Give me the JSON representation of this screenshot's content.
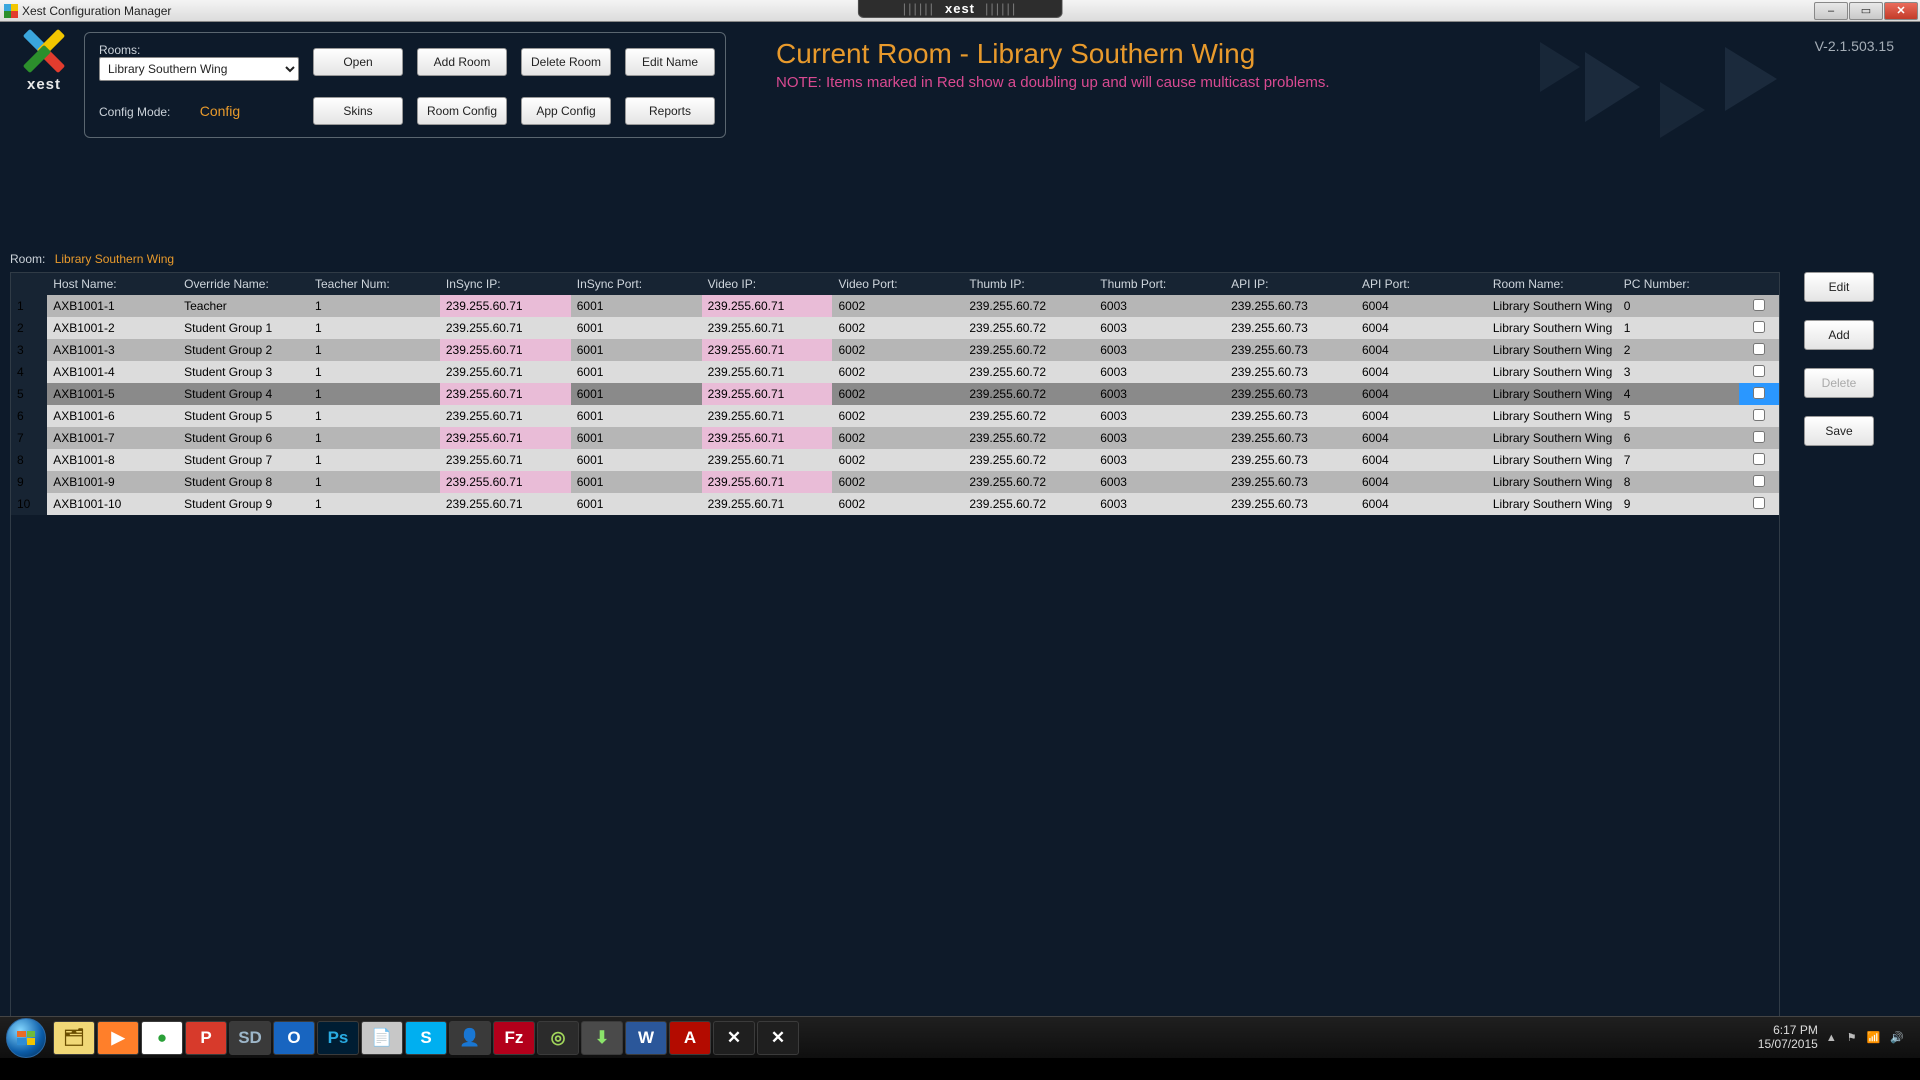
{
  "window": {
    "title": "Xest Configuration Manager",
    "brand": "xest"
  },
  "winbtns": {
    "min": "–",
    "max": "▭",
    "close": "✕"
  },
  "logo_text": "xest",
  "version": "V-2.1.503.15",
  "panel": {
    "rooms_label": "Rooms:",
    "room_selected": "Library Southern Wing",
    "config_mode_label": "Config Mode:",
    "config_mode_value": "Config",
    "buttons": {
      "open": "Open",
      "add_room": "Add Room",
      "delete_room": "Delete Room",
      "edit_name": "Edit Name",
      "skins": "Skins",
      "room_config": "Room Config",
      "app_config": "App Config",
      "reports": "Reports"
    }
  },
  "room_title": {
    "heading": "Current Room - Library Southern Wing",
    "note": "NOTE: Items marked in Red show a doubling up and will cause multicast problems."
  },
  "grid_header_room_label": "Room:",
  "grid_header_room_value": "Library Southern Wing",
  "columns": [
    "Host Name:",
    "Override Name:",
    "Teacher Num:",
    "InSync IP:",
    "InSync Port:",
    "Video IP:",
    "Video Port:",
    "Thumb IP:",
    "Thumb Port:",
    "API IP:",
    "API Port:",
    "Room Name:",
    "PC Number:"
  ],
  "selected_row": 5,
  "rows": [
    {
      "host": "AXB1001-1",
      "override": "Teacher",
      "tnum": "1",
      "insync_ip": "239.255.60.71",
      "insync_port": "6001",
      "video_ip": "239.255.60.71",
      "video_port": "6002",
      "thumb_ip": "239.255.60.72",
      "thumb_port": "6003",
      "api_ip": "239.255.60.73",
      "api_port": "6004",
      "room": "Library Southern Wing",
      "pc": "0"
    },
    {
      "host": "AXB1001-2",
      "override": "Student Group 1",
      "tnum": "1",
      "insync_ip": "239.255.60.71",
      "insync_port": "6001",
      "video_ip": "239.255.60.71",
      "video_port": "6002",
      "thumb_ip": "239.255.60.72",
      "thumb_port": "6003",
      "api_ip": "239.255.60.73",
      "api_port": "6004",
      "room": "Library Southern Wing",
      "pc": "1"
    },
    {
      "host": "AXB1001-3",
      "override": "Student Group 2",
      "tnum": "1",
      "insync_ip": "239.255.60.71",
      "insync_port": "6001",
      "video_ip": "239.255.60.71",
      "video_port": "6002",
      "thumb_ip": "239.255.60.72",
      "thumb_port": "6003",
      "api_ip": "239.255.60.73",
      "api_port": "6004",
      "room": "Library Southern Wing",
      "pc": "2"
    },
    {
      "host": "AXB1001-4",
      "override": "Student Group 3",
      "tnum": "1",
      "insync_ip": "239.255.60.71",
      "insync_port": "6001",
      "video_ip": "239.255.60.71",
      "video_port": "6002",
      "thumb_ip": "239.255.60.72",
      "thumb_port": "6003",
      "api_ip": "239.255.60.73",
      "api_port": "6004",
      "room": "Library Southern Wing",
      "pc": "3"
    },
    {
      "host": "AXB1001-5",
      "override": "Student Group 4",
      "tnum": "1",
      "insync_ip": "239.255.60.71",
      "insync_port": "6001",
      "video_ip": "239.255.60.71",
      "video_port": "6002",
      "thumb_ip": "239.255.60.72",
      "thumb_port": "6003",
      "api_ip": "239.255.60.73",
      "api_port": "6004",
      "room": "Library Southern Wing",
      "pc": "4"
    },
    {
      "host": "AXB1001-6",
      "override": "Student Group 5",
      "tnum": "1",
      "insync_ip": "239.255.60.71",
      "insync_port": "6001",
      "video_ip": "239.255.60.71",
      "video_port": "6002",
      "thumb_ip": "239.255.60.72",
      "thumb_port": "6003",
      "api_ip": "239.255.60.73",
      "api_port": "6004",
      "room": "Library Southern Wing",
      "pc": "5"
    },
    {
      "host": "AXB1001-7",
      "override": "Student Group 6",
      "tnum": "1",
      "insync_ip": "239.255.60.71",
      "insync_port": "6001",
      "video_ip": "239.255.60.71",
      "video_port": "6002",
      "thumb_ip": "239.255.60.72",
      "thumb_port": "6003",
      "api_ip": "239.255.60.73",
      "api_port": "6004",
      "room": "Library Southern Wing",
      "pc": "6"
    },
    {
      "host": "AXB1001-8",
      "override": "Student Group 7",
      "tnum": "1",
      "insync_ip": "239.255.60.71",
      "insync_port": "6001",
      "video_ip": "239.255.60.71",
      "video_port": "6002",
      "thumb_ip": "239.255.60.72",
      "thumb_port": "6003",
      "api_ip": "239.255.60.73",
      "api_port": "6004",
      "room": "Library Southern Wing",
      "pc": "7"
    },
    {
      "host": "AXB1001-9",
      "override": "Student Group 8",
      "tnum": "1",
      "insync_ip": "239.255.60.71",
      "insync_port": "6001",
      "video_ip": "239.255.60.71",
      "video_port": "6002",
      "thumb_ip": "239.255.60.72",
      "thumb_port": "6003",
      "api_ip": "239.255.60.73",
      "api_port": "6004",
      "room": "Library Southern Wing",
      "pc": "8"
    },
    {
      "host": "AXB1001-10",
      "override": "Student Group 9",
      "tnum": "1",
      "insync_ip": "239.255.60.71",
      "insync_port": "6001",
      "video_ip": "239.255.60.71",
      "video_port": "6002",
      "thumb_ip": "239.255.60.72",
      "thumb_port": "6003",
      "api_ip": "239.255.60.73",
      "api_port": "6004",
      "room": "Library Southern Wing",
      "pc": "9"
    }
  ],
  "sidebtns": {
    "edit": "Edit",
    "add": "Add",
    "delete": "Delete",
    "save": "Save"
  },
  "taskbar": {
    "items": [
      {
        "bg": "#f1d877",
        "fg": "#6b4e00",
        "txt": "🗂"
      },
      {
        "bg": "#ff7f2a",
        "fg": "#fff",
        "txt": "▶"
      },
      {
        "bg": "#ffffff",
        "fg": "#2aa038",
        "txt": "●"
      },
      {
        "bg": "#d73a2b",
        "fg": "#fff",
        "txt": "P"
      },
      {
        "bg": "#3a3a3a",
        "fg": "#9db6c9",
        "txt": "SD"
      },
      {
        "bg": "#1865c0",
        "fg": "#fff",
        "txt": "O"
      },
      {
        "bg": "#001d33",
        "fg": "#29abe2",
        "txt": "Ps"
      },
      {
        "bg": "#c7c7c7",
        "fg": "#333",
        "txt": "📄"
      },
      {
        "bg": "#00aff0",
        "fg": "#fff",
        "txt": "S"
      },
      {
        "bg": "#3a3a3a",
        "fg": "#f6c026",
        "txt": "👤"
      },
      {
        "bg": "#b3001b",
        "fg": "#fff",
        "txt": "Fz"
      },
      {
        "bg": "#2b2b2b",
        "fg": "#a2d65b",
        "txt": "◎"
      },
      {
        "bg": "#4a4a4a",
        "fg": "#8be46a",
        "txt": "⬇"
      },
      {
        "bg": "#2b579a",
        "fg": "#fff",
        "txt": "W"
      },
      {
        "bg": "#b30b00",
        "fg": "#fff",
        "txt": "A"
      },
      {
        "bg": "#1f1f1f",
        "fg": "#fff",
        "txt": "✕"
      },
      {
        "bg": "#1f1f1f",
        "fg": "#fff",
        "txt": "✕"
      }
    ],
    "tray": {
      "arrow": "▲",
      "flag": "⚑",
      "net": "📶",
      "vol": "🔊"
    },
    "time": "6:17 PM",
    "date": "15/07/2015"
  }
}
